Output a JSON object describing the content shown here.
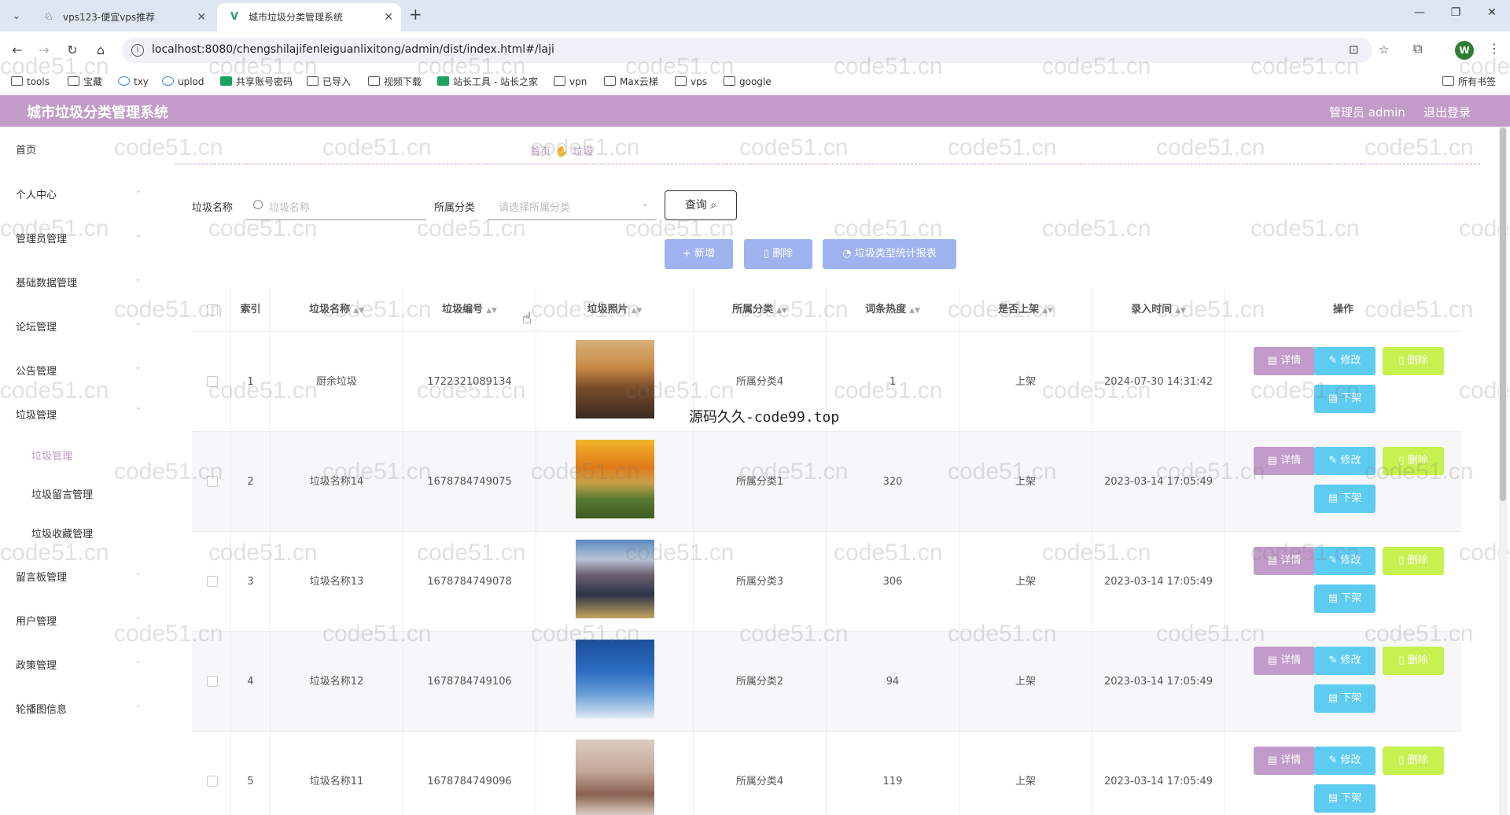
{
  "browser": {
    "tabs": [
      {
        "title": "vps123-便宜vps推荐"
      },
      {
        "title": "城市垃圾分类管理系统"
      }
    ],
    "url": "localhost:8080/chengshilajifenleiguanlixitong/admin/dist/index.html#/laji",
    "profile_initial": "W",
    "bookmarks": [
      "tools",
      "宝藏",
      "txy",
      "uplod",
      "共享账号密码",
      "已导入",
      "视频下载",
      "站长工具 - 站长之家",
      "vpn",
      "Max云梯",
      "vps",
      "google"
    ],
    "all_bookmarks": "所有书签"
  },
  "app": {
    "title": "城市垃圾分类管理系统",
    "user": "管理员 admin",
    "logout": "退出登录"
  },
  "sidebar": {
    "items": [
      {
        "label": "首页"
      },
      {
        "label": "个人中心"
      },
      {
        "label": "管理员管理"
      },
      {
        "label": "基础数据管理"
      },
      {
        "label": "论坛管理"
      },
      {
        "label": "公告管理"
      },
      {
        "label": "垃圾管理"
      },
      {
        "label": "留言板管理"
      },
      {
        "label": "用户管理"
      },
      {
        "label": "政策管理"
      },
      {
        "label": "轮播图信息"
      }
    ],
    "subitems": [
      {
        "label": "垃圾管理"
      },
      {
        "label": "垃圾留言管理"
      },
      {
        "label": "垃圾收藏管理"
      }
    ]
  },
  "breadcrumb": {
    "home": "首页",
    "current": "垃圾"
  },
  "search": {
    "name_label": "垃圾名称",
    "name_placeholder": "垃圾名称",
    "category_label": "所属分类",
    "category_placeholder": "请选择所属分类",
    "query_button": "查询"
  },
  "actions": {
    "add": "新增",
    "delete": "删除",
    "report": "垃圾类型统计报表"
  },
  "table": {
    "columns": [
      "索引",
      "垃圾名称",
      "垃圾编号",
      "垃圾照片",
      "所属分类",
      "词条热度",
      "是否上架",
      "录入时间",
      "操作"
    ],
    "buttons": {
      "detail": "详情",
      "edit": "修改",
      "delete": "删除",
      "unshelve": "下架"
    },
    "rows": [
      {
        "index": "1",
        "name": "厨余垃圾",
        "code": "1722321089134",
        "category": "所属分类4",
        "heat": "1",
        "shelf": "上架",
        "time": "2024-07-30 14:31:42"
      },
      {
        "index": "2",
        "name": "垃圾名称14",
        "code": "1678784749075",
        "category": "所属分类1",
        "heat": "320",
        "shelf": "上架",
        "time": "2023-03-14 17:05:49"
      },
      {
        "index": "3",
        "name": "垃圾名称13",
        "code": "1678784749078",
        "category": "所属分类3",
        "heat": "306",
        "shelf": "上架",
        "time": "2023-03-14 17:05:49"
      },
      {
        "index": "4",
        "name": "垃圾名称12",
        "code": "1678784749106",
        "category": "所属分类2",
        "heat": "94",
        "shelf": "上架",
        "time": "2023-03-14 17:05:49"
      },
      {
        "index": "5",
        "name": "垃圾名称11",
        "code": "1678784749096",
        "category": "所属分类4",
        "heat": "119",
        "shelf": "上架",
        "time": "2023-03-14 17:05:49"
      }
    ]
  },
  "watermark": "code51.cn",
  "overlay_text": "源码久久-code99.top"
}
